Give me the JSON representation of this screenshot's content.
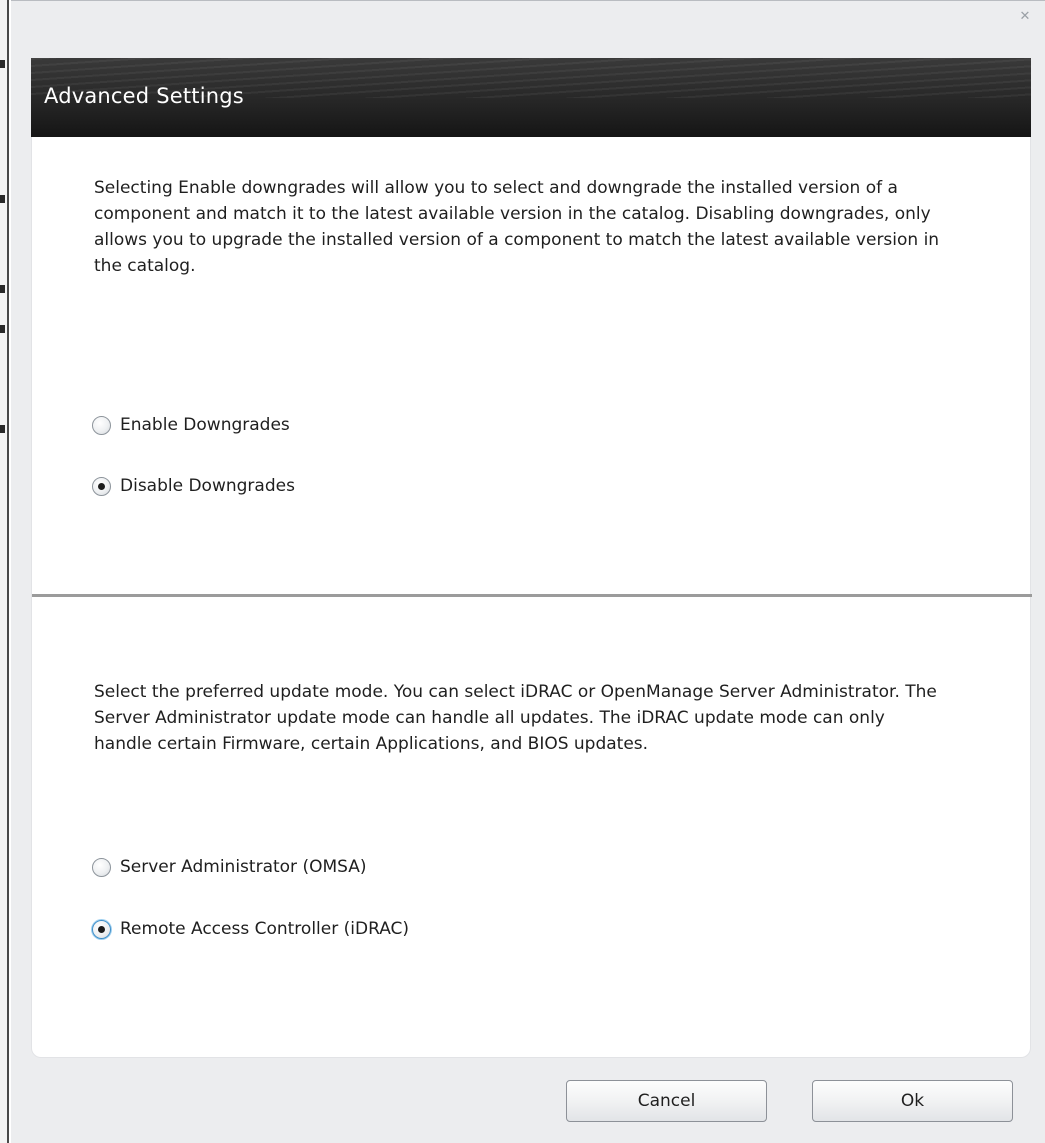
{
  "window": {
    "close_glyph": "✕"
  },
  "header": {
    "title": "Advanced Settings"
  },
  "downgrade_section": {
    "description": "Selecting Enable downgrades will allow you to select and downgrade the installed version of a component and match it to the latest available version in the catalog. Disabling downgrades, only allows you to upgrade the installed version of a component to match the latest available version in the catalog.",
    "options": [
      {
        "label": "Enable Downgrades",
        "selected": false
      },
      {
        "label": "Disable Downgrades",
        "selected": true
      }
    ]
  },
  "update_mode_section": {
    "description": "Select the preferred update mode. You can select iDRAC or OpenManage Server Administrator. The Server Administrator update mode can handle all updates. The iDRAC update mode can only handle certain Firmware, certain Applications, and BIOS updates.",
    "options": [
      {
        "label": "Server Administrator (OMSA)",
        "selected": false
      },
      {
        "label": "Remote Access Controller (iDRAC)",
        "selected": true
      }
    ]
  },
  "footer": {
    "cancel_label": "Cancel",
    "ok_label": "Ok"
  },
  "icons": {
    "close": "close-icon"
  },
  "colors": {
    "header_bg": "#1e1e1e",
    "dialog_bg": "#ecedef",
    "panel_bg": "#ffffff",
    "divider": "#9b9b9b",
    "focus": "#3d8ec9"
  }
}
